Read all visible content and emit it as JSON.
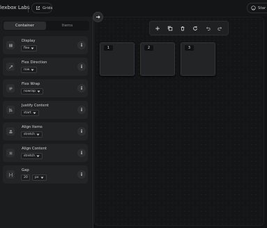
{
  "topbar": {
    "brand": "lexbox Labs",
    "grids_label": "Grids",
    "star_label": "Star"
  },
  "tabs": [
    {
      "label": "Container",
      "active": true
    },
    {
      "label": "Items",
      "active": false
    }
  ],
  "properties": {
    "display": {
      "label": "Display",
      "value": "flex",
      "icon": "display-icon"
    },
    "flex_direction": {
      "label": "Flex Direction",
      "value": "row",
      "icon": "direction-icon"
    },
    "flex_wrap": {
      "label": "Flex Wrap",
      "value": "nowrap",
      "icon": "wrap-icon"
    },
    "justify_content": {
      "label": "Justify Content",
      "value": "start",
      "icon": "justify-icon"
    },
    "align_items": {
      "label": "Align Items",
      "value": "stretch",
      "icon": "align-items-icon"
    },
    "align_content": {
      "label": "Align Content",
      "value": "stretch",
      "icon": "align-content-icon"
    },
    "gap": {
      "label": "Gap",
      "value": "20",
      "unit": "px",
      "icon": "gap-icon"
    }
  },
  "info_glyph": "i",
  "toolbar": [
    "add-icon",
    "duplicate-icon",
    "delete-icon",
    "reset-icon",
    "undo-icon",
    "redo-icon"
  ],
  "items": [
    {
      "label": "1"
    },
    {
      "label": "2"
    },
    {
      "label": "3"
    }
  ],
  "colors": {
    "background": "#111213",
    "panel": "#1b1c1e",
    "card": "#232426"
  }
}
